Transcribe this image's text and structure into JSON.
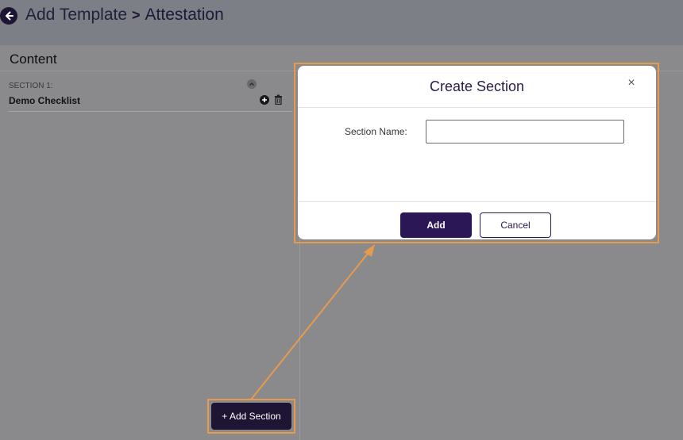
{
  "header": {
    "parent_crumb": "Add Template",
    "separator": ">",
    "current_crumb": "Attestation"
  },
  "content": {
    "title": "Content",
    "section": {
      "label": "SECTION 1:",
      "name": "Demo Checklist"
    },
    "add_section_label": "+ Add Section"
  },
  "modal": {
    "title": "Create Section",
    "close_label": "×",
    "field_label": "Section Name:",
    "field_value": "",
    "add_label": "Add",
    "cancel_label": "Cancel"
  },
  "icons": {
    "back": "arrow-left-circle-icon",
    "collapse": "chevron-up-icon",
    "add": "plus-circle-icon",
    "delete": "trash-icon"
  },
  "colors": {
    "brand": "#1e1433",
    "highlight": "#e89a4c"
  }
}
